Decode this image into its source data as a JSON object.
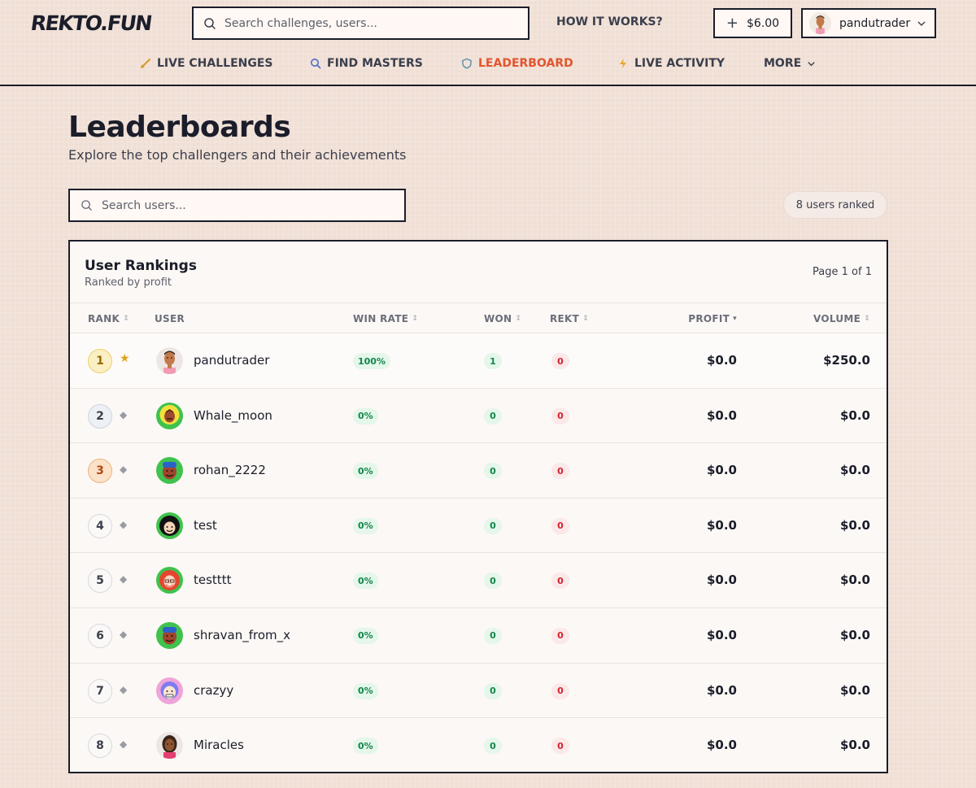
{
  "header": {
    "logo": "REKTO.FUN",
    "search_placeholder": "Search challenges, users...",
    "how_it_works": "HOW IT WORKS?",
    "balance": "$6.00",
    "username": "pandutrader"
  },
  "nav": {
    "items": [
      {
        "label": "LIVE CHALLENGES",
        "icon": "sword-icon"
      },
      {
        "label": "FIND MASTERS",
        "icon": "search-icon"
      },
      {
        "label": "LEADERBOARD",
        "icon": "shield-icon",
        "active": true
      },
      {
        "label": "LIVE ACTIVITY",
        "icon": "lightning-icon"
      },
      {
        "label": "MORE",
        "icon": "chevron-down-icon"
      }
    ]
  },
  "page": {
    "title": "Leaderboards",
    "subtitle": "Explore the top challengers and their achievements",
    "search_placeholder": "Search users...",
    "users_ranked": "8 users ranked"
  },
  "card": {
    "title": "User Rankings",
    "subtitle": "Ranked by profit",
    "page_indicator": "Page 1 of 1"
  },
  "columns": {
    "rank": "RANK",
    "user": "USER",
    "win_rate": "WIN RATE",
    "won": "WON",
    "rekt": "REKT",
    "profit": "PROFIT",
    "volume": "VOLUME"
  },
  "rows": [
    {
      "rank": "1",
      "user": "pandutrader",
      "win_rate": "100%",
      "won": "1",
      "rekt": "0",
      "profit": "$0.0",
      "volume": "$250.0"
    },
    {
      "rank": "2",
      "user": "Whale_moon",
      "win_rate": "0%",
      "won": "0",
      "rekt": "0",
      "profit": "$0.0",
      "volume": "$0.0"
    },
    {
      "rank": "3",
      "user": "rohan_2222",
      "win_rate": "0%",
      "won": "0",
      "rekt": "0",
      "profit": "$0.0",
      "volume": "$0.0"
    },
    {
      "rank": "4",
      "user": "test",
      "win_rate": "0%",
      "won": "0",
      "rekt": "0",
      "profit": "$0.0",
      "volume": "$0.0"
    },
    {
      "rank": "5",
      "user": "testttt",
      "win_rate": "0%",
      "won": "0",
      "rekt": "0",
      "profit": "$0.0",
      "volume": "$0.0"
    },
    {
      "rank": "6",
      "user": "shravan_from_x",
      "win_rate": "0%",
      "won": "0",
      "rekt": "0",
      "profit": "$0.0",
      "volume": "$0.0"
    },
    {
      "rank": "7",
      "user": "crazyy",
      "win_rate": "0%",
      "won": "0",
      "rekt": "0",
      "profit": "$0.0",
      "volume": "$0.0"
    },
    {
      "rank": "8",
      "user": "Miracles",
      "win_rate": "0%",
      "won": "0",
      "rekt": "0",
      "profit": "$0.0",
      "volume": "$0.0"
    }
  ],
  "colors": {
    "background": "#f0dfd5",
    "accent": "#e2552e",
    "ink": "#1b1d2a",
    "positive": "#12864a",
    "negative": "#d3222f"
  }
}
